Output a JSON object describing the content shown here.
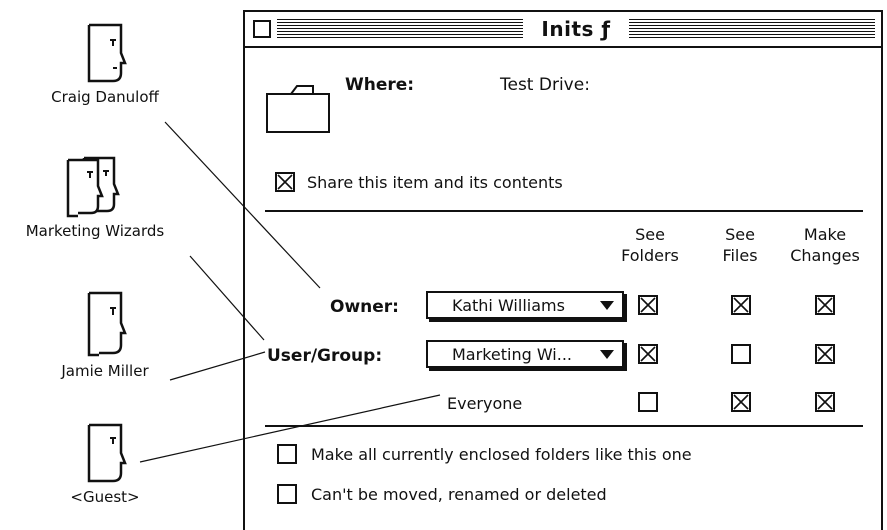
{
  "users": [
    {
      "label": "Craig Danuloff",
      "icon": "user-icon"
    },
    {
      "label": "Marketing Wizards",
      "icon": "group-icon"
    },
    {
      "label": "Jamie Miller",
      "icon": "user-icon"
    },
    {
      "label": "<Guest>",
      "icon": "guest-icon"
    }
  ],
  "window": {
    "title": "Inits ƒ",
    "where_label": "Where:",
    "where_value": "Test Drive:",
    "share_label": "Share this item and its contents",
    "share_checked": true,
    "columns": [
      "See Folders",
      "See Files",
      "Make Changes"
    ],
    "col_lines": [
      [
        "See",
        "Folders"
      ],
      [
        "See",
        "Files"
      ],
      [
        "Make",
        "Changes"
      ]
    ],
    "rows": [
      {
        "label": "Owner:",
        "popup": "Kathi Williams",
        "checks": [
          true,
          true,
          true
        ]
      },
      {
        "label": "User/Group:",
        "popup": "Marketing Wi...",
        "checks": [
          true,
          false,
          true
        ]
      },
      {
        "label": "Everyone",
        "checks": [
          false,
          true,
          true
        ]
      }
    ],
    "option1": "Make all currently enclosed folders like this one",
    "option2": "Can't be moved, renamed or deleted"
  }
}
